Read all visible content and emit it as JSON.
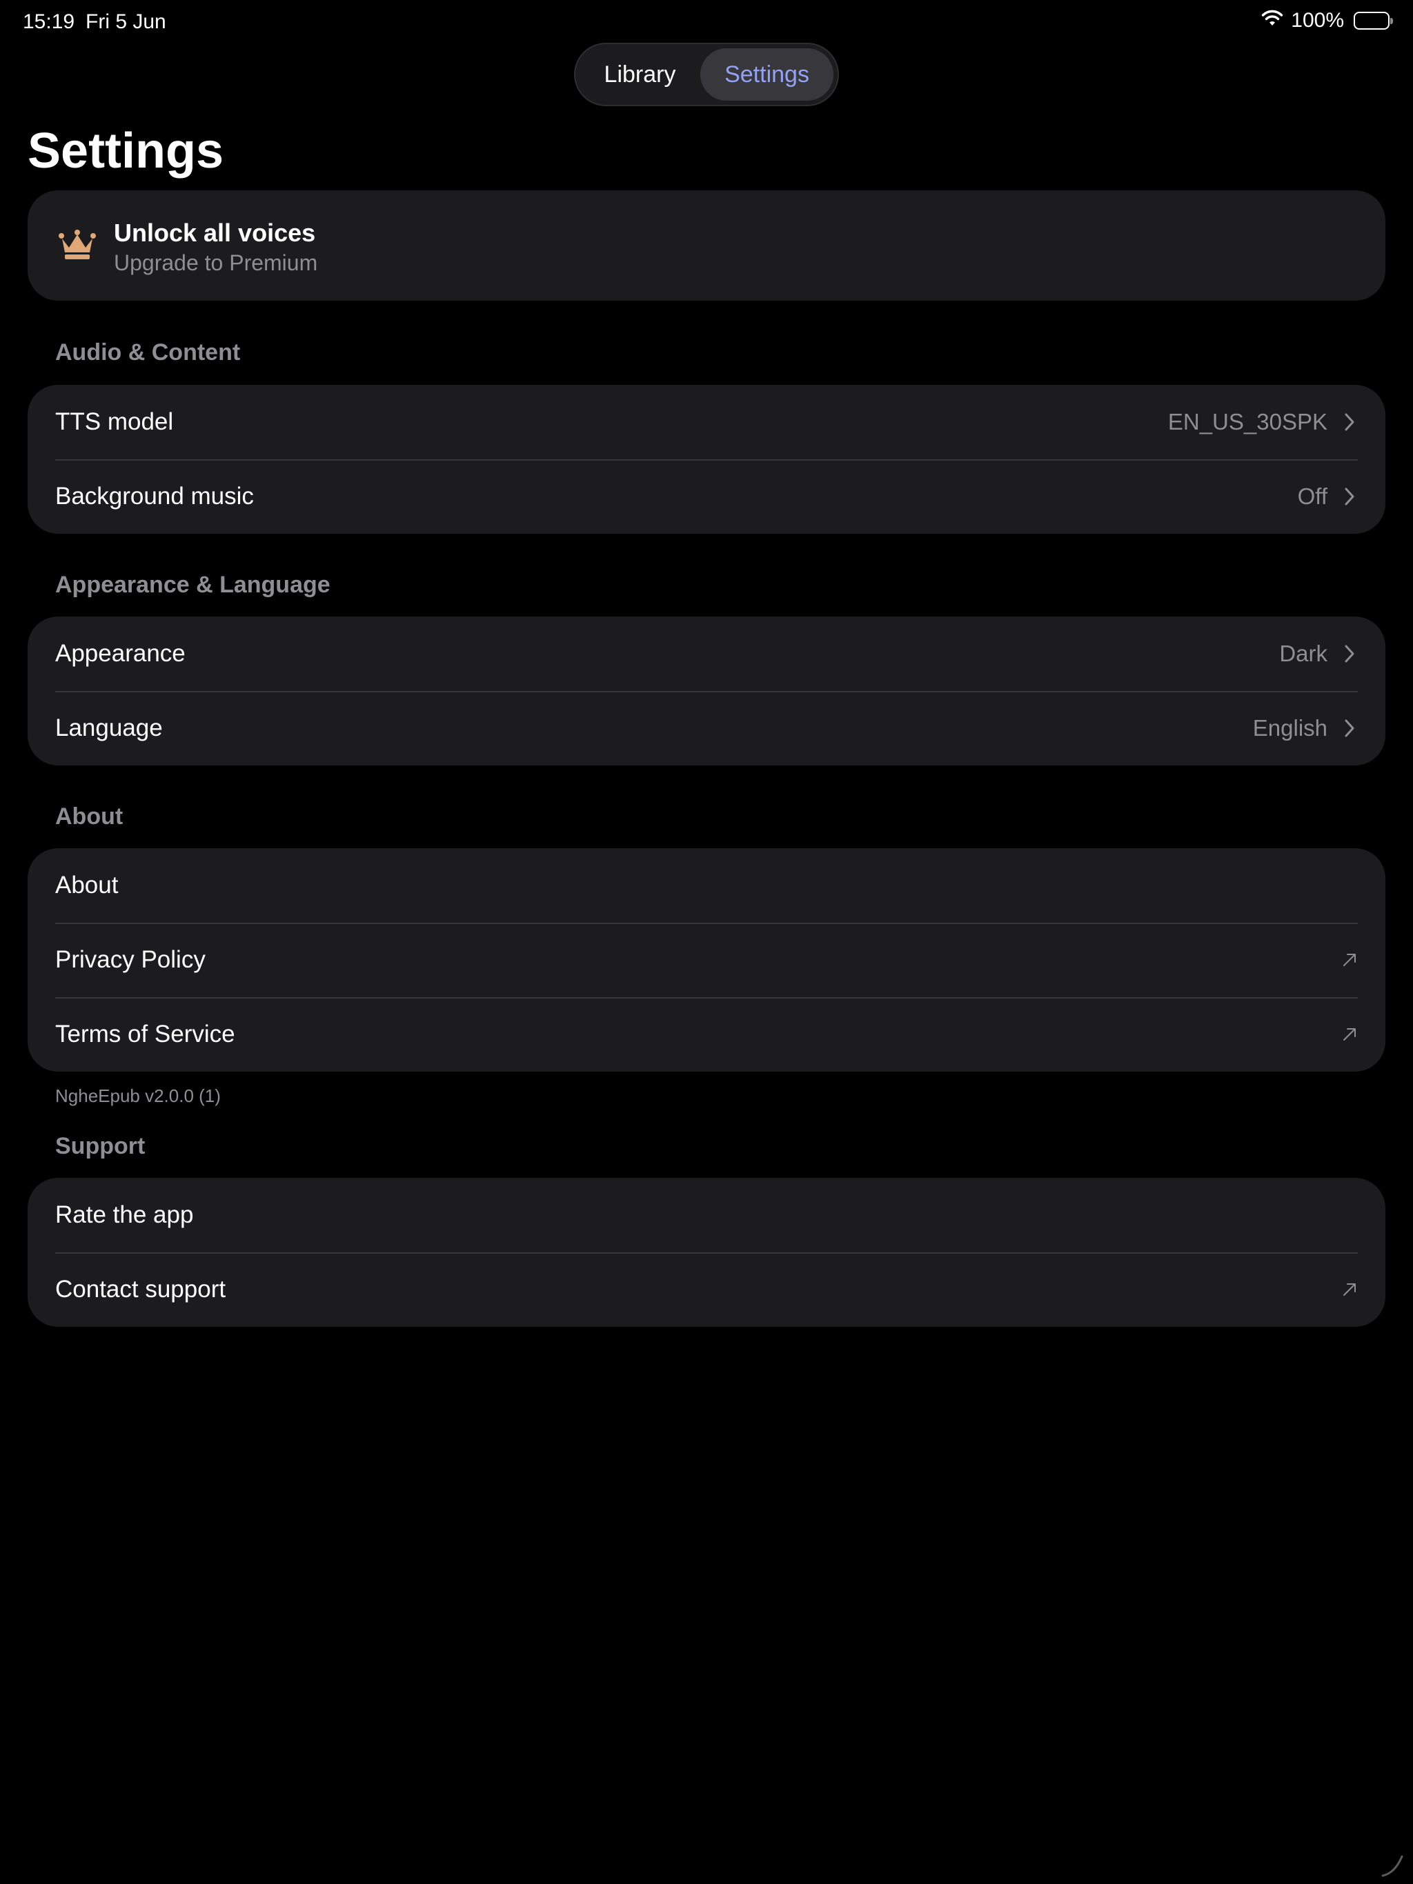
{
  "status_bar": {
    "time": "15:19",
    "date": "Fri 5 Jun",
    "battery_text": "100%",
    "battery_level": 1.0,
    "icons": [
      "wifi-icon",
      "battery-icon"
    ]
  },
  "segmented": {
    "library_label": "Library",
    "settings_label": "Settings",
    "selected": "Settings",
    "selected_color": "#93a2f5"
  },
  "page": {
    "title": "Settings"
  },
  "premium": {
    "title": "Unlock all voices",
    "subtitle": "Upgrade to Premium",
    "icon": "crown-icon",
    "icon_color": "#e0a877"
  },
  "sections": {
    "audio": {
      "header": "Audio & Content",
      "rows": [
        {
          "label": "TTS model",
          "value": "EN_US_30SPK",
          "icon": "chevron-right-icon"
        },
        {
          "label": "Background music",
          "value": "Off",
          "icon": "chevron-right-icon"
        }
      ]
    },
    "appearance": {
      "header": "Appearance & Language",
      "rows": [
        {
          "label": "Appearance",
          "value": "Dark",
          "icon": "chevron-right-icon"
        },
        {
          "label": "Language",
          "value": "English",
          "icon": "chevron-right-icon"
        }
      ]
    },
    "about": {
      "header": "About",
      "rows": [
        {
          "label": "About"
        },
        {
          "label": "Privacy Policy",
          "icon": "external-link-icon"
        },
        {
          "label": "Terms of Service",
          "icon": "external-link-icon"
        }
      ],
      "version": "NgheEpub v2.0.0 (1)"
    },
    "support": {
      "header": "Support",
      "rows": [
        {
          "label": "Rate the app"
        },
        {
          "label": "Contact support",
          "icon": "external-link-icon"
        }
      ]
    }
  },
  "colors": {
    "background": "#000000",
    "card": "#1c1c1e",
    "secondary_text": "#8e8e93",
    "separator": "#38383c"
  }
}
